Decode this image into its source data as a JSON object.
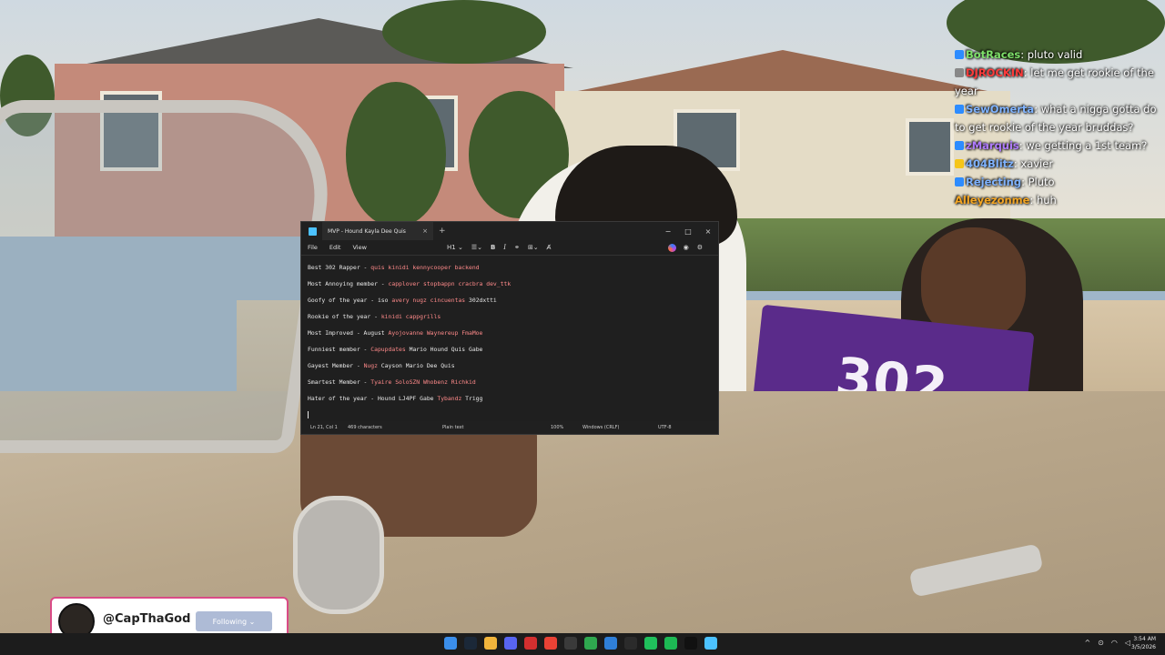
{
  "notepad": {
    "tab_title": "MVP - Hound Kayla Dee Quis",
    "tab_close": "×",
    "new_tab": "+",
    "window_controls": {
      "minimize": "−",
      "maximize": "□",
      "close": "×"
    },
    "menu": [
      "File",
      "Edit",
      "View"
    ],
    "heading_tool": "H1 ⌄",
    "lines": [
      {
        "label": "Best 302 Rapper - ",
        "names": "quis kinidi kennycooper backend"
      },
      {
        "label": "Most Annoying member - ",
        "names": "capplover stopbappn cracbra dev_ttk"
      },
      {
        "label": "Goofy of the year - iso ",
        "names": "avery nugz cincuentas",
        "extra": " 302dxtti"
      },
      {
        "label": "Rookie of the year - ",
        "names": "kinidi cappgrills"
      },
      {
        "label": "Most Improved - August ",
        "names": "Ayojovanne Waynereup FmaMoe"
      },
      {
        "label": "Funniest member - ",
        "names": "Capupdates",
        "extra": " Mario Hound Quis Gabe"
      },
      {
        "label": "Gayest Member - ",
        "names": "Nugz",
        "extra": " Cayson Mario Dee Quis"
      },
      {
        "label": "Smartest Member - ",
        "names": "Tyaire SoloSZN Whobenz Richkid"
      },
      {
        "label": "Hater of the year - Hound LJ4PF Gabe ",
        "names": "Tybandz",
        "extra": " Trigg"
      }
    ],
    "status": {
      "position": "Ln 21, Col 1",
      "characters": "469 characters",
      "format": "Plain text",
      "zoom": "100%",
      "line_ending": "Windows (CRLF)",
      "encoding": "UTF-8"
    }
  },
  "chat": [
    {
      "user": "BotRaces",
      "user_color": "#7ee06a",
      "message": ": pluto valid",
      "badge_color": "#2d8cff"
    },
    {
      "user": "DJROCKIN",
      "user_color": "#ff3b3b",
      "message": ": let me get rookie of the year",
      "badge_color": "#888888"
    },
    {
      "user": "SewOmerta",
      "user_color": "#7fb3ff",
      "message": ": what a nigga gotta do to get rookie of the year bruddas?",
      "badge_color": "#2d8cff"
    },
    {
      "user": "zMarquis",
      "user_color": "#b07cff",
      "message": ": we getting a 1st team?",
      "badge_color": "#2d8cff"
    },
    {
      "user": "404Blitz",
      "user_color": "#7fb3ff",
      "message": ": xavier",
      "badge_color": "#f5c518"
    },
    {
      "user": "Rejecting",
      "user_color": "#7fb3ff",
      "message": ": Pluto",
      "badge_color": "#2d8cff"
    },
    {
      "user": "Alleyezonme",
      "user_color": "#f5a623",
      "message": ": huh",
      "badge_color": ""
    }
  ],
  "bandana_text": "302",
  "follow_card": {
    "handle": "@CapThaGod",
    "button": "Following ⌄"
  },
  "taskbar": {
    "time": "3:54 AM",
    "date": "3/5/2026",
    "apps": [
      {
        "name": "start",
        "color": "#3b8eea"
      },
      {
        "name": "steam",
        "color": "#1b2838"
      },
      {
        "name": "file-explorer",
        "color": "#f2b53c"
      },
      {
        "name": "discord",
        "color": "#5865f2"
      },
      {
        "name": "acrobat",
        "color": "#d32f2f"
      },
      {
        "name": "chrome",
        "color": "#e94235"
      },
      {
        "name": "xbox",
        "color": "#3a3a3a"
      },
      {
        "name": "app-green",
        "color": "#2fa84f"
      },
      {
        "name": "app-blue",
        "color": "#2f7fd8"
      },
      {
        "name": "obs",
        "color": "#2b2b2b"
      },
      {
        "name": "app-teal",
        "color": "#20c05c"
      },
      {
        "name": "spotify",
        "color": "#1db954"
      },
      {
        "name": "capcut",
        "color": "#111111"
      },
      {
        "name": "notepad",
        "color": "#4cc2ff"
      }
    ]
  }
}
